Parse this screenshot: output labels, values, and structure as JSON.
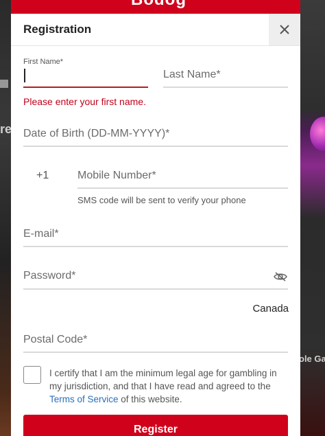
{
  "brand": {
    "logo_text": "Bodog",
    "accent_color": "#d0021b"
  },
  "background": {
    "left_text": "re",
    "right_label": "ole Ga"
  },
  "dialog": {
    "title": "Registration",
    "close_icon": "close-icon"
  },
  "form": {
    "first_name": {
      "label": "First Name*",
      "value": ""
    },
    "first_name_error": "Please enter your first name.",
    "last_name": {
      "placeholder": "Last Name*"
    },
    "dob": {
      "placeholder": "Date of Birth (DD-MM-YYYY)*"
    },
    "phone_prefix": "+1",
    "mobile": {
      "placeholder": "Mobile Number*"
    },
    "sms_hint": "SMS code will be sent to verify your phone",
    "email": {
      "placeholder": "E-mail*"
    },
    "password": {
      "placeholder": "Password*",
      "toggle_icon": "eye-slash-icon"
    },
    "country": "Canada",
    "postal_code": {
      "placeholder": "Postal Code*"
    },
    "consent": {
      "text_before": "I certify that I am the minimum legal age for gambling in my jurisdiction, and that I have read and agreed to the ",
      "link_text": "Terms of Service",
      "text_after": " of this website.",
      "checked": false
    },
    "submit_label": "Register"
  }
}
